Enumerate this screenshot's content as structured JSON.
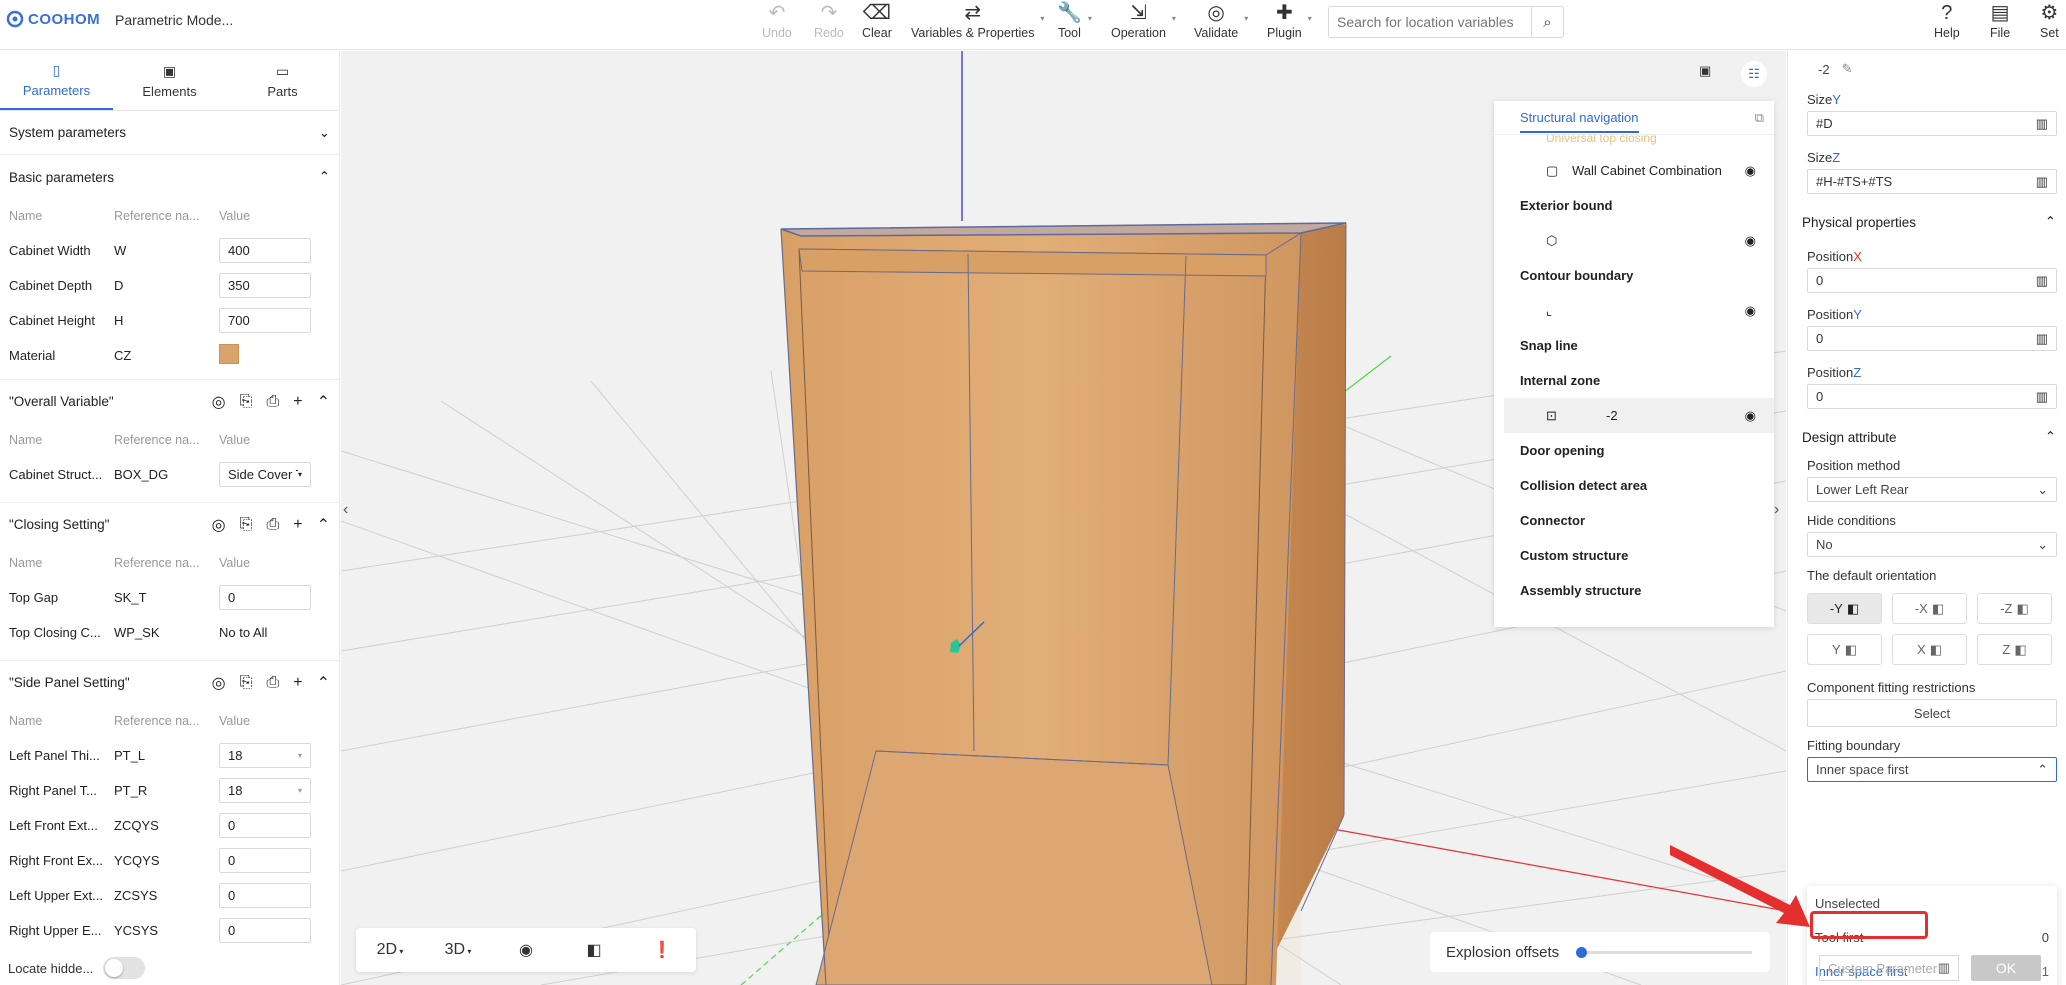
{
  "app": {
    "logo": "COOHOM",
    "doc_title": "Parametric Mode..."
  },
  "toolbar": {
    "items": [
      {
        "label": "Undo",
        "icon": "undo-icon",
        "disabled": true
      },
      {
        "label": "Redo",
        "icon": "redo-icon",
        "disabled": true
      },
      {
        "label": "Clear",
        "icon": "eraser-icon"
      },
      {
        "label": "Variables & Properties",
        "icon": "variables-icon"
      },
      {
        "label": "Tool",
        "icon": "wrench-icon"
      },
      {
        "label": "Operation",
        "icon": "operation-icon"
      },
      {
        "label": "Validate",
        "icon": "validate-icon"
      },
      {
        "label": "Plugin",
        "icon": "puzzle-icon"
      }
    ],
    "search_placeholder": "Search for location variables",
    "right_items": [
      {
        "label": "Help",
        "icon": "help-icon"
      },
      {
        "label": "File",
        "icon": "file-icon"
      },
      {
        "label": "Set",
        "icon": "gear-icon"
      }
    ]
  },
  "left_panel": {
    "tabs": [
      "Parameters",
      "Elements",
      "Parts"
    ],
    "system_parameters": "System parameters",
    "basic_parameters": "Basic parameters",
    "col_headers": {
      "name": "Name",
      "ref": "Reference na...",
      "value": "Value"
    },
    "basic_rows": [
      {
        "name": "Cabinet Width",
        "ref": "W",
        "value": "400"
      },
      {
        "name": "Cabinet Depth",
        "ref": "D",
        "value": "350"
      },
      {
        "name": "Cabinet Height",
        "ref": "H",
        "value": "700"
      },
      {
        "name": "Material",
        "ref": "CZ",
        "value": ""
      }
    ],
    "overall_variable": {
      "title": "\"Overall Variable\"",
      "rows": [
        {
          "name": "Cabinet Struct...",
          "ref": "BOX_DG",
          "value": "Side Cover T"
        }
      ]
    },
    "closing_setting": {
      "title": "\"Closing Setting\"",
      "rows": [
        {
          "name": "Top Gap",
          "ref": "SK_T",
          "value": "0"
        },
        {
          "name": "Top Closing C...",
          "ref": "WP_SK",
          "value": "No to All"
        }
      ]
    },
    "side_panel_setting": {
      "title": "\"Side Panel Setting\"",
      "rows": [
        {
          "name": "Left Panel Thi...",
          "ref": "PT_L",
          "value": "18"
        },
        {
          "name": "Right Panel T...",
          "ref": "PT_R",
          "value": "18"
        },
        {
          "name": "Left Front Ext...",
          "ref": "ZCQYS",
          "value": "0"
        },
        {
          "name": "Right Front Ex...",
          "ref": "YCQYS",
          "value": "0"
        },
        {
          "name": "Left Upper Ext...",
          "ref": "ZCSYS",
          "value": "0"
        },
        {
          "name": "Right Upper E...",
          "ref": "YCSYS",
          "value": "0"
        }
      ]
    },
    "footer_label": "Locate hidde..."
  },
  "viewport": {
    "view_2d": "2D",
    "view_3d": "3D",
    "explosion_label": "Explosion offsets",
    "explosion_value": 0
  },
  "structural_nav": {
    "title": "Structural navigation",
    "partial_top": "Universal top closing",
    "items": [
      {
        "type": "child",
        "label": "Wall Cabinet Combination"
      },
      {
        "type": "group",
        "label": "Exterior bound"
      },
      {
        "type": "child",
        "label": ""
      },
      {
        "type": "group",
        "label": "Contour boundary"
      },
      {
        "type": "child",
        "label": ""
      },
      {
        "type": "group",
        "label": "Snap line"
      },
      {
        "type": "group",
        "label": "Internal zone"
      },
      {
        "type": "child",
        "label": "-2",
        "selected": true
      },
      {
        "type": "group",
        "label": "Door opening"
      },
      {
        "type": "group",
        "label": "Collision detect area"
      },
      {
        "type": "group",
        "label": "Connector"
      },
      {
        "type": "group",
        "label": "Custom structure"
      },
      {
        "type": "group",
        "label": "Assembly structure"
      }
    ]
  },
  "right_panel": {
    "header_name": "-2",
    "size_y_label": "Size",
    "size_y_axis": "Y",
    "size_y_value": "#D",
    "size_z_label": "Size",
    "size_z_axis": "Z",
    "size_z_value": "#H-#TS+#TS",
    "physical_properties": "Physical properties",
    "position_x_label": "Position",
    "position_x_axis": "X",
    "position_x": "0",
    "position_y_label": "Position",
    "position_y_axis": "Y",
    "position_y": "0",
    "position_z_label": "Position",
    "position_z_axis": "Z",
    "position_z": "0",
    "design_attribute": "Design attribute",
    "position_method_label": "Position method",
    "position_method": "Lower Left Rear",
    "hide_conditions_label": "Hide conditions",
    "hide_conditions": "No",
    "default_orientation_label": "The default orientation",
    "orientations": [
      "-Y",
      "-X",
      "-Z",
      "Y",
      "X",
      "Z"
    ],
    "fitting_restrictions_label": "Component fitting restrictions",
    "select_label": "Select",
    "fitting_boundary_label": "Fitting boundary",
    "fitting_boundary_value": "Inner space first",
    "dropdown_options": [
      {
        "label": "Unselected",
        "value": ""
      },
      {
        "label": "Tool first",
        "value": "0"
      },
      {
        "label": "Inner space first",
        "value": "1"
      }
    ],
    "custom_param_placeholder": "Custom Parameters",
    "ok_label": "OK"
  },
  "colors": {
    "accent": "#2f6bd8",
    "highlight": "#e52f2f",
    "wood": "#d9a36c"
  }
}
